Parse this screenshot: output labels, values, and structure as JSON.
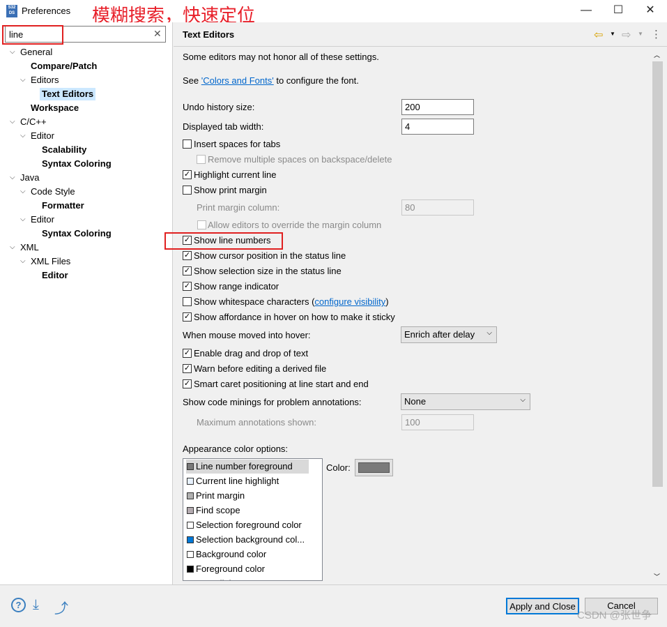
{
  "window": {
    "title": "Preferences",
    "logo": "S32 DS",
    "annotation": "模糊搜索，快速定位",
    "minimize": "—",
    "maximize": "☐",
    "close": "✕"
  },
  "search": {
    "value": "line",
    "clear": "✕"
  },
  "tree": [
    {
      "label": "General",
      "level": 0,
      "expanded": true
    },
    {
      "label": "Compare/Patch",
      "level": 1,
      "bold": true
    },
    {
      "label": "Editors",
      "level": 1,
      "expanded": true
    },
    {
      "label": "Text Editors",
      "level": 2,
      "bold": true,
      "selected": true
    },
    {
      "label": "Workspace",
      "level": 1,
      "bold": true
    },
    {
      "label": "C/C++",
      "level": 0,
      "expanded": true
    },
    {
      "label": "Editor",
      "level": 1,
      "expanded": true
    },
    {
      "label": "Scalability",
      "level": 2,
      "bold": true
    },
    {
      "label": "Syntax Coloring",
      "level": 2,
      "bold": true
    },
    {
      "label": "Java",
      "level": 0,
      "expanded": true
    },
    {
      "label": "Code Style",
      "level": 1,
      "expanded": true
    },
    {
      "label": "Formatter",
      "level": 2,
      "bold": true
    },
    {
      "label": "Editor",
      "level": 1,
      "expanded": true
    },
    {
      "label": "Syntax Coloring",
      "level": 2,
      "bold": true
    },
    {
      "label": "XML",
      "level": 0,
      "expanded": true
    },
    {
      "label": "XML Files",
      "level": 1,
      "expanded": true
    },
    {
      "label": "Editor",
      "level": 2,
      "bold": true
    }
  ],
  "page": {
    "title": "Text Editors",
    "nav": {
      "back": "⇦",
      "forward": "⇨",
      "menu": "⋮"
    },
    "note": "Some editors may not honor all of these settings.",
    "see_prefix": "See ",
    "see_link": "'Colors and Fonts'",
    "see_suffix": " to configure the font.",
    "undo_label": "Undo history size:",
    "undo_value": "200",
    "tab_label": "Displayed tab width:",
    "tab_value": "4",
    "checks": [
      {
        "label": "Insert spaces for tabs",
        "checked": false
      },
      {
        "label": "Remove multiple spaces on backspace/delete",
        "checked": false,
        "disabled": true
      },
      {
        "label": "Highlight current line",
        "checked": true
      },
      {
        "label": "Show print margin",
        "checked": false
      }
    ],
    "margin_label": "Print margin column:",
    "margin_value": "80",
    "allow_override": "Allow editors to override the margin column",
    "checks2": [
      {
        "label": "Show line numbers",
        "checked": true
      },
      {
        "label": "Show cursor position in the status line",
        "checked": true
      },
      {
        "label": "Show selection size in the status line",
        "checked": true
      },
      {
        "label": "Show range indicator",
        "checked": true
      }
    ],
    "whitespace_label": "Show whitespace characters (",
    "whitespace_link": "configure visibility",
    "whitespace_end": ")",
    "affordance": "Show affordance in hover on how to make it sticky",
    "hover_label": "When mouse moved into hover:",
    "hover_value": "Enrich after delay",
    "checks3": [
      {
        "label": "Enable drag and drop of text",
        "checked": true
      },
      {
        "label": "Warn before editing a derived file",
        "checked": true
      },
      {
        "label": "Smart caret positioning at line start and end",
        "checked": true
      }
    ],
    "minings_label": "Show code minings for problem annotations:",
    "minings_value": "None",
    "max_ann_label": "Maximum annotations shown:",
    "max_ann_value": "100",
    "appearance_label": "Appearance color options:",
    "color_label": "Color:",
    "color_value": "#7a7a7a",
    "color_items": [
      {
        "label": "Line number foreground",
        "color": "#7a7a7a",
        "selected": true
      },
      {
        "label": "Current line highlight",
        "color": "#e8f2fe"
      },
      {
        "label": "Print margin",
        "color": "#b0b0b0"
      },
      {
        "label": "Find scope",
        "color": "#b4abb0"
      },
      {
        "label": "Selection foreground color",
        "color": "#ffffff"
      },
      {
        "label": "Selection background col...",
        "color": "#0078d7"
      },
      {
        "label": "Background color",
        "color": "#ffffff"
      },
      {
        "label": "Foreground color",
        "color": "#000000"
      },
      {
        "label": "Hyperlink",
        "color": "#0078d7"
      }
    ]
  },
  "footer": {
    "apply_close": "Apply and Close",
    "cancel": "Cancel",
    "watermark": "CSDN @张世争"
  }
}
